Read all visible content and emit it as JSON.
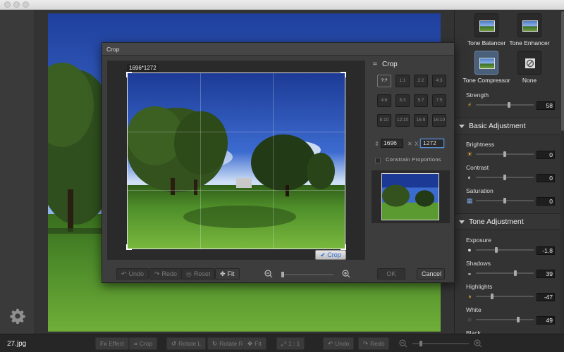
{
  "window": {
    "filename": "27.jpg"
  },
  "bottom_toolbar": [
    {
      "icon": "effect-icon",
      "glyph": "Fx",
      "label": "Effect"
    },
    {
      "icon": "crop-icon",
      "glyph": "⌗",
      "label": "Crop"
    },
    {
      "icon": "rotate-left-icon",
      "glyph": "↺",
      "label": "Rotate L"
    },
    {
      "icon": "rotate-right-icon",
      "glyph": "↻",
      "label": "Rotate R"
    },
    {
      "icon": "fit-icon",
      "glyph": "✥",
      "label": "Fit"
    },
    {
      "icon": "actual-size-icon",
      "glyph": "⤢",
      "label": "1 : 1"
    },
    {
      "icon": "undo-icon",
      "glyph": "↶",
      "label": "Undo"
    },
    {
      "icon": "redo-icon",
      "glyph": "↷",
      "label": "Redo"
    }
  ],
  "right_panel": {
    "tones": [
      {
        "label": "Tone Balancer",
        "active": false
      },
      {
        "label": "Tone Enhancer",
        "active": false
      },
      {
        "label": "Tone Compressor",
        "active": true
      },
      {
        "label": "None",
        "active": false
      }
    ],
    "strength": {
      "label": "Strength",
      "value": "58",
      "level": 0.58
    },
    "basic_adjustment": {
      "title": "Basic Adjustment",
      "params": [
        {
          "label": "Brightness",
          "value": "0",
          "level": 0.5,
          "icon": "sun-icon",
          "glyph": "☀",
          "color": "#f2a93b"
        },
        {
          "label": "Contrast",
          "value": "0",
          "level": 0.5,
          "icon": "contrast-icon",
          "glyph": "◐",
          "color": "#dddddd"
        },
        {
          "label": "Saturation",
          "value": "0",
          "level": 0.5,
          "icon": "saturation-icon",
          "glyph": "▦",
          "color": "#7aa7e0"
        }
      ]
    },
    "tone_adjustment": {
      "title": "Tone Adjustment",
      "params": [
        {
          "label": "Exposure",
          "value": "-1.8",
          "level": 0.35,
          "icon": "exposure-icon",
          "glyph": "●",
          "color": "#dddddd"
        },
        {
          "label": "Shadows",
          "value": "39",
          "level": 0.69,
          "icon": "shadows-icon",
          "glyph": "◒",
          "color": "#dddddd"
        },
        {
          "label": "Highlights",
          "value": "-47",
          "level": 0.27,
          "icon": "highlights-icon",
          "glyph": "◑",
          "color": "#f2a93b"
        },
        {
          "label": "White",
          "value": "49",
          "level": 0.74,
          "icon": "white-icon",
          "glyph": "◌",
          "color": "#dddddd"
        },
        {
          "label": "Black",
          "value": "",
          "level": 0.5,
          "icon": "black-icon",
          "glyph": "●",
          "color": "#dddddd"
        }
      ]
    }
  },
  "crop_dialog": {
    "title": "Crop",
    "dimensions_badge": "1696*1272",
    "confirm_label": "Crop",
    "section_title": "Crop",
    "ratios": [
      "?:?",
      "1:1",
      "2:2",
      "4:3",
      "4:6",
      "5:3",
      "5:7",
      "7:5",
      "8:10",
      "12:10",
      "16:9",
      "16:10"
    ],
    "active_ratio": 0,
    "width": "1696",
    "height": "1272",
    "constrain_label": "Constrain Proportions",
    "buttons": {
      "undo": "Undo",
      "redo": "Redo",
      "reset": "Reset",
      "fit": "Fit",
      "ok": "OK",
      "cancel": "Cancel"
    }
  }
}
